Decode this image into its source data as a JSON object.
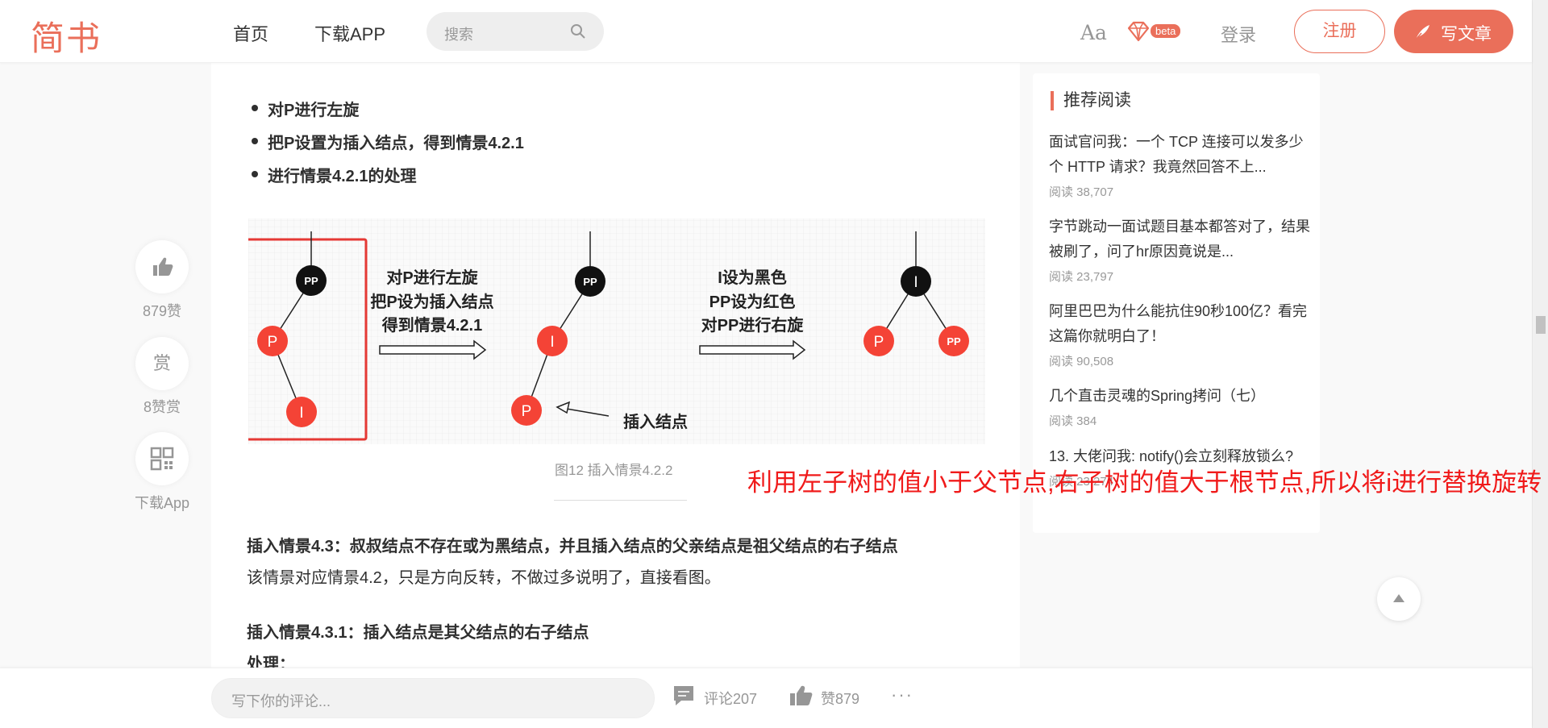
{
  "colors": {
    "accent": "#ea6f5a",
    "annotation": "#f01a1a",
    "node_red": "#f44336",
    "node_black": "#111111"
  },
  "header": {
    "logo": "简书",
    "nav": {
      "home": "首页",
      "download_app": "下载APP"
    },
    "search": {
      "placeholder": "搜索",
      "icon": "search-icon"
    },
    "aa": "Aa",
    "beta": "beta",
    "login": "登录",
    "register": "注册",
    "write": "写文章"
  },
  "article": {
    "bullets": [
      "对P进行左旋",
      "把P设置为插入结点，得到情景4.2.1",
      "进行情景4.2.1的处理"
    ],
    "figure": {
      "step1_lines": [
        "对P进行左旋",
        "把P设为插入结点",
        "得到情景4.2.1"
      ],
      "step2_lines": [
        "I设为黑色",
        "PP设为红色",
        "对PP进行右旋"
      ],
      "insert_label": "插入结点",
      "nodes": {
        "pp": "PP",
        "p": "P",
        "i": "I"
      }
    },
    "caption": "图12 插入情景4.2.2",
    "p1": "插入情景4.3：叔叔结点不存在或为黑结点，并且插入结点的父亲结点是祖父结点的右子结点",
    "p2": "该情景对应情景4.2，只是方向反转，不做过多说明了，直接看图。",
    "p3": "插入情景4.3.1：插入结点是其父结点的右子结点",
    "p4": "处理："
  },
  "actions": {
    "like_count": "879赞",
    "reward_glyph": "赏",
    "reward_count": "8赞赏",
    "download": "下载App"
  },
  "sidebar": {
    "title": "推荐阅读",
    "items": [
      {
        "title": "面试官问我：一个 TCP 连接可以发多少个 HTTP 请求？我竟然回答不上...",
        "reads": "阅读 38,707"
      },
      {
        "title": "字节跳动一面试题目基本都答对了，结果被刷了，问了hr原因竟说是...",
        "reads": "阅读 23,797"
      },
      {
        "title": "阿里巴巴为什么能抗住90秒100亿？看完这篇你就明白了！",
        "reads": "阅读 90,508"
      },
      {
        "title": "几个直击灵魂的Spring拷问（七）",
        "reads": "阅读 384"
      },
      {
        "title": "13. 大佬问我: notify()会立刻释放锁么?",
        "reads": "阅读 23,274"
      }
    ]
  },
  "annotation": "利用左子树的值小于父节点,右子树的值大于根节点,所以将i进行替换旋转",
  "bottom": {
    "comment_placeholder": "写下你的评论...",
    "comments": "评论207",
    "likes": "赞879",
    "more": "···"
  }
}
